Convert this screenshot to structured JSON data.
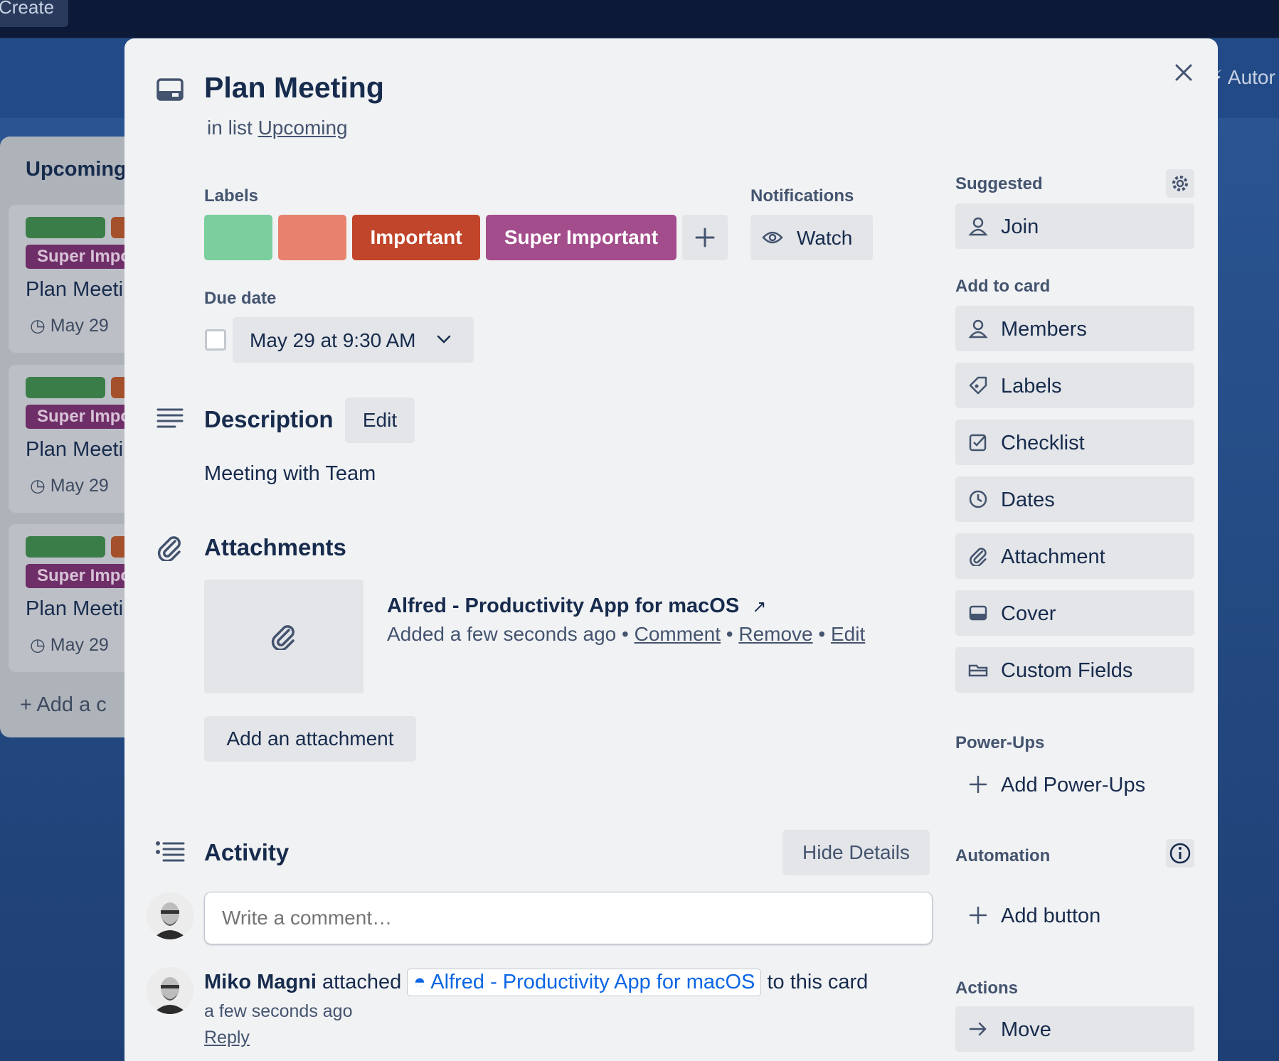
{
  "background": {
    "create_label": "Create",
    "automation_label": "Autor",
    "list_title": "Upcoming",
    "card_tag": "Super Impc",
    "card_title": "Plan Meeti",
    "card_date": "May 29",
    "add_card": "Add a c"
  },
  "card": {
    "title": "Plan Meeting",
    "in_list_prefix": "in list",
    "list_name": "Upcoming"
  },
  "labels": {
    "heading": "Labels",
    "items": [
      {
        "text": "",
        "color": "#7bcf9e"
      },
      {
        "text": "",
        "color": "#e8826c"
      },
      {
        "text": "Important",
        "color": "#c1452a"
      },
      {
        "text": "Super Important",
        "color": "#a44d8c"
      }
    ],
    "add_icon": "plus-icon"
  },
  "notifications": {
    "heading": "Notifications",
    "watch_label": "Watch"
  },
  "due_date": {
    "heading": "Due date",
    "value": "May 29 at 9:30 AM"
  },
  "description": {
    "heading": "Description",
    "edit_label": "Edit",
    "text": "Meeting with Team"
  },
  "attachments": {
    "heading": "Attachments",
    "item_name": "Alfred - Productivity App for macOS",
    "item_added": "Added a few seconds ago",
    "comment_label": "Comment",
    "remove_label": "Remove",
    "edit_label": "Edit",
    "add_label": "Add an attachment"
  },
  "activity": {
    "heading": "Activity",
    "hide_details": "Hide Details",
    "comment_placeholder": "Write a comment…",
    "entry_user": "Miko Magni",
    "entry_action": "attached",
    "entry_link": "Alfred - Productivity App for macOS",
    "entry_suffix": "to this card",
    "entry_time": "a few seconds ago",
    "reply_label": "Reply"
  },
  "sidebar": {
    "suggested_heading": "Suggested",
    "join_label": "Join",
    "add_to_card_heading": "Add to card",
    "add_to_card_items": [
      "Members",
      "Labels",
      "Checklist",
      "Dates",
      "Attachment",
      "Cover",
      "Custom Fields"
    ],
    "powerups_heading": "Power-Ups",
    "add_powerups": "Add Power-Ups",
    "automation_heading": "Automation",
    "add_button": "Add button",
    "actions_heading": "Actions",
    "move_label": "Move"
  },
  "colors": {
    "accent_link": "#0c66e4",
    "modal_bg": "#f1f2f4",
    "button_bg": "#e3e5e8"
  }
}
